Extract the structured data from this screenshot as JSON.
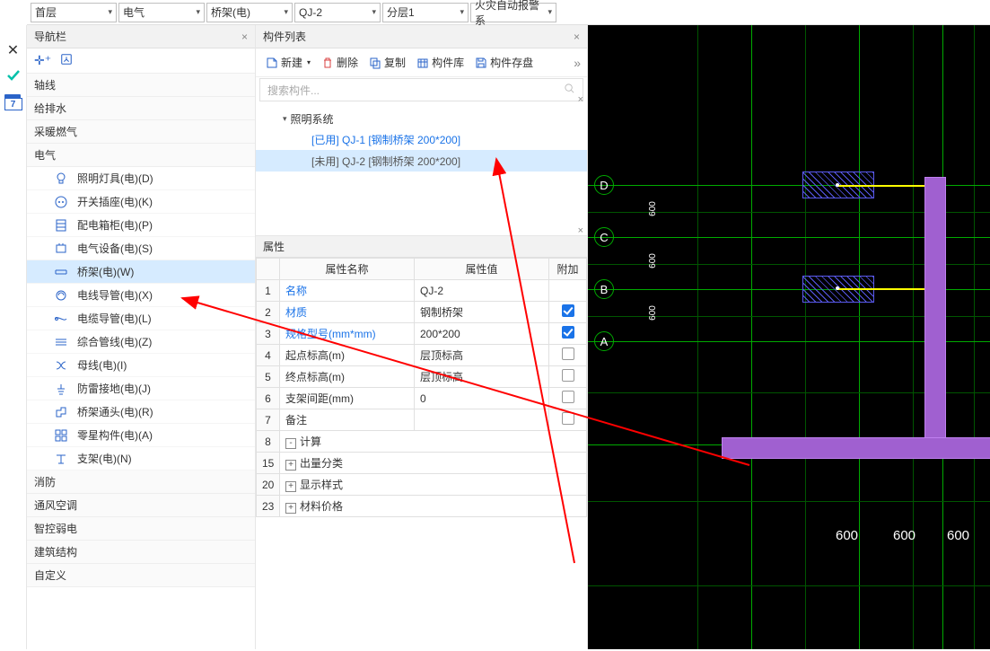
{
  "topbar": {
    "sel": [
      "首层",
      "电气",
      "桥架(电)",
      "QJ-2",
      "分层1",
      "火灾自动报警系"
    ]
  },
  "leftbar": {
    "cal_day": "7"
  },
  "nav": {
    "title": "导航栏",
    "groups": {
      "axis": "轴线",
      "water": "给排水",
      "gas": "采暖燃气",
      "elec": "电气",
      "fire": "消防",
      "hvac": "通风空调",
      "weak": "智控弱电",
      "struct": "建筑结构",
      "custom": "自定义"
    },
    "elec_items": [
      {
        "icon": "bulb",
        "label": "照明灯具(电)(D)"
      },
      {
        "icon": "outlet",
        "label": "开关插座(电)(K)"
      },
      {
        "icon": "panel",
        "label": "配电箱柜(电)(P)"
      },
      {
        "icon": "device",
        "label": "电气设备(电)(S)"
      },
      {
        "icon": "tray",
        "label": "桥架(电)(W)",
        "sel": true
      },
      {
        "icon": "conduit",
        "label": "电线导管(电)(X)"
      },
      {
        "icon": "cable",
        "label": "电缆导管(电)(L)"
      },
      {
        "icon": "combo",
        "label": "综合管线(电)(Z)"
      },
      {
        "icon": "bus",
        "label": "母线(电)(I)"
      },
      {
        "icon": "ground",
        "label": "防雷接地(电)(J)"
      },
      {
        "icon": "fitting",
        "label": "桥架通头(电)(R)"
      },
      {
        "icon": "misc",
        "label": "零星构件(电)(A)"
      },
      {
        "icon": "support",
        "label": "支架(电)(N)"
      }
    ]
  },
  "complist": {
    "title": "构件列表",
    "tools": {
      "new": "新建",
      "del": "删除",
      "copy": "复制",
      "lib": "构件库",
      "save": "构件存盘"
    },
    "search_ph": "搜索构件...",
    "tree": {
      "root": "照明系统",
      "items": [
        {
          "tag": "[已用]",
          "label": "QJ-1 [钢制桥架 200*200]",
          "used": true
        },
        {
          "tag": "[未用]",
          "label": "QJ-2 [钢制桥架 200*200]",
          "used": false,
          "sel": true
        }
      ]
    }
  },
  "props": {
    "title": "属性",
    "cols": {
      "name": "属性名称",
      "val": "属性值",
      "add": "附加"
    },
    "rows": [
      {
        "i": "1",
        "name": "名称",
        "link": true,
        "val": "QJ-2",
        "chk": null
      },
      {
        "i": "2",
        "name": "材质",
        "link": true,
        "val": "钢制桥架",
        "chk": true
      },
      {
        "i": "3",
        "name": "规格型号(mm*mm)",
        "link": true,
        "val": "200*200",
        "chk": true
      },
      {
        "i": "4",
        "name": "起点标高(m)",
        "val": "层顶标高",
        "chk": false
      },
      {
        "i": "5",
        "name": "终点标高(m)",
        "val": "层顶标高",
        "chk": false
      },
      {
        "i": "6",
        "name": "支架间距(mm)",
        "val": "0",
        "chk": false
      },
      {
        "i": "7",
        "name": "备注",
        "val": "",
        "chk": false
      },
      {
        "i": "8",
        "name": "计算",
        "exp": "-"
      },
      {
        "i": "15",
        "name": "出量分类",
        "exp": "+"
      },
      {
        "i": "20",
        "name": "显示样式",
        "exp": "+"
      },
      {
        "i": "23",
        "name": "材料价格",
        "exp": "+"
      }
    ]
  },
  "canvas": {
    "rows": [
      "D",
      "C",
      "B",
      "A"
    ],
    "dim_y": [
      "600",
      "600",
      "600"
    ],
    "dim_x": [
      "600",
      "600",
      "600"
    ]
  }
}
